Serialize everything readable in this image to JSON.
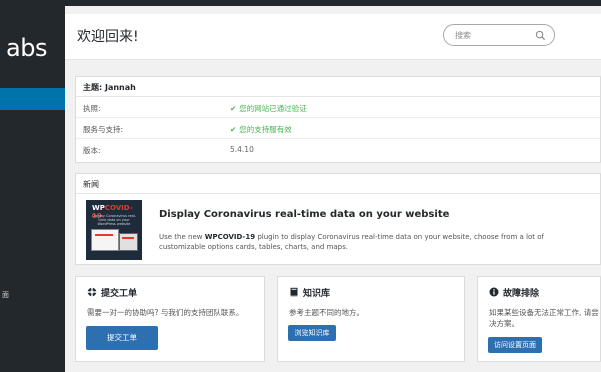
{
  "sidebar": {
    "logo_text": "abs",
    "partial_item_label": "面"
  },
  "header": {
    "title": "欢迎回来!",
    "search_placeholder": "搜索",
    "search_icon": "search-icon"
  },
  "theme": {
    "heading": "主题: Jannah",
    "rows": [
      {
        "label": "执照:",
        "value": "您的网站已通过验证",
        "status": "ok"
      },
      {
        "label": "服务与支持:",
        "value": "您的支持服有效",
        "status": "ok"
      },
      {
        "label": "版本:",
        "value": "5.4.10",
        "status": "plain"
      }
    ],
    "ok_color": "#46b450"
  },
  "news": {
    "heading": "新闻",
    "thumb_brand_prefix": "WP",
    "thumb_brand_accent": "COVID-19",
    "thumb_subtitle": "Display Coronavirus real-time data on your WordPress website",
    "title": "Display Coronavirus real-time data on your website",
    "text_prefix": "Use the new ",
    "text_plugin": "WPCOVID-19",
    "text_suffix": " plugin to display Coronavirus real-time data on your website, choose from a lot of customizable options cards, tables, charts, and maps."
  },
  "cards": [
    {
      "title": "提交工单",
      "icon": "lifebuoy-icon",
      "text": "需要一对一的协助吗? 与我们的支持团队联系。",
      "button": "提交工单"
    },
    {
      "title": "知识库",
      "icon": "book-icon",
      "text": "参考主题不同的地方。",
      "button": "浏览知识库"
    },
    {
      "title": "故障排除",
      "icon": "info-icon",
      "text": "如果某些设备无法正常工作, 请尝",
      "text2": "决方案。",
      "button": "访问设置页面"
    }
  ],
  "colors": {
    "accent": "#0073aa",
    "button": "#2e6fb0",
    "admin_bar": "#23282d"
  }
}
